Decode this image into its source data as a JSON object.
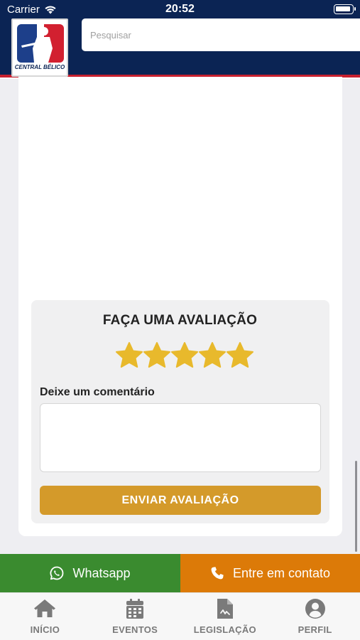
{
  "status_bar": {
    "carrier": "Carrier",
    "time": "20:52"
  },
  "header": {
    "logo_text": "CENTRAL BÉLICO",
    "search": {
      "placeholder": "Pesquisar",
      "value": ""
    }
  },
  "review": {
    "title": "FAÇA UMA AVALIAÇÃO",
    "rating": 5,
    "max_rating": 5,
    "comment_label": "Deixe um comentário",
    "comment_value": "",
    "submit_label": "ENVIAR AVALIAÇÃO"
  },
  "contact": {
    "whatsapp_label": "Whatsapp",
    "contact_label": "Entre em contato"
  },
  "tabs": [
    {
      "label": "INÍCIO",
      "icon": "home-icon"
    },
    {
      "label": "EVENTOS",
      "icon": "calendar-icon"
    },
    {
      "label": "LEGISLAÇÃO",
      "icon": "document-icon"
    },
    {
      "label": "PERFIL",
      "icon": "user-icon"
    }
  ],
  "colors": {
    "header_bg": "#0b2454",
    "accent_red": "#c8202f",
    "star": "#e8b92c",
    "submit_bg": "#d49a2a",
    "whatsapp_bg": "#3a8b2f",
    "contact_bg": "#dc7a08",
    "tab_inactive": "#7a7a7a"
  }
}
